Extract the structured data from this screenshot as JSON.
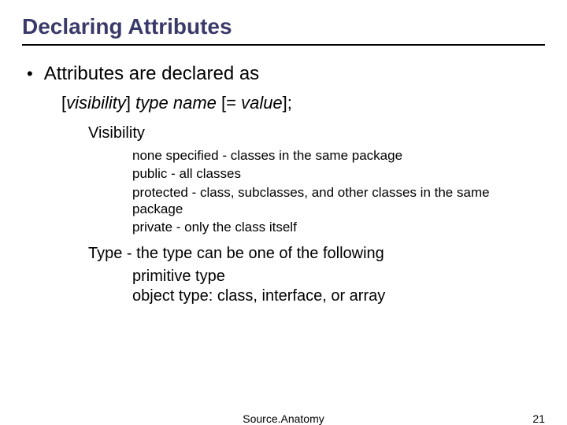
{
  "title": "Declaring Attributes",
  "bullet1": "Attributes are declared as",
  "syntax": {
    "open": "[",
    "visibility": "visibility",
    "close_bracket": "]",
    "type": " type name ",
    "eq_open": "[= ",
    "value": "value",
    "eq_close": "];"
  },
  "visibility": {
    "header": "Visibility",
    "items": [
      "none specified - classes in the same package",
      "public - all classes",
      "protected - class, subclasses, and other classes in the same package",
      "private - only the class itself"
    ]
  },
  "type": {
    "header": "Type - the type can be one of the following",
    "items": [
      "primitive type",
      "object type: class, interface, or array"
    ]
  },
  "footer": {
    "center": "Source.Anatomy",
    "page": "21"
  }
}
